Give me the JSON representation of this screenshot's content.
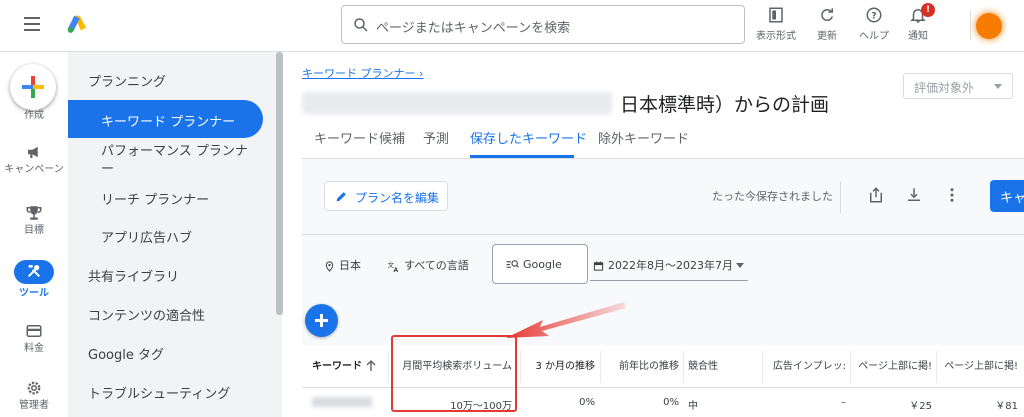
{
  "topbar": {
    "search_placeholder": "ページまたはキャンペーンを検索",
    "items": [
      {
        "label": "表示形式",
        "icon": "display-format-icon"
      },
      {
        "label": "更新",
        "icon": "refresh-icon"
      },
      {
        "label": "ヘルプ",
        "icon": "help-icon"
      },
      {
        "label": "通知",
        "icon": "bell-icon"
      }
    ],
    "notif_badge": "!"
  },
  "rail": {
    "create": "作成",
    "campaign": "キャンペーン",
    "goals": "目標",
    "tools": "ツール",
    "billing": "料金",
    "admin": "管理者"
  },
  "sidebar": {
    "planning": "プランニング",
    "keyword_planner": "キーワード プランナー",
    "performance_planner_line1": "パフォーマンス プランナ",
    "performance_planner_line2": "ー",
    "reach_planner": "リーチ プランナー",
    "app_ad_hub": "アプリ広告ハブ",
    "shared_library": "共有ライブラリ",
    "content_suitability": "コンテンツの適合性",
    "google_tag": "Google タグ",
    "troubleshooting": "トラブルシューティング"
  },
  "main": {
    "breadcrumb": "キーワード プランナー ›",
    "title": "日本標準時）からの計画",
    "eval_select": "評価対象外",
    "tabs": [
      "キーワード候補",
      "予測",
      "保存したキーワード",
      "除外キーワード"
    ],
    "edit_plan": "プラン名を編集",
    "saved_status": "たった今保存されました",
    "blue_button": "キャン",
    "filters": {
      "location": "日本",
      "language": "すべての言語",
      "network": "Google",
      "date_range": "2022年8月～2023年7月"
    },
    "table": {
      "headers": {
        "keyword": "キーワード",
        "avg_monthly": "月間平均検索ボリューム",
        "three_month": "3 か月の推移",
        "yoy": "前年比の推移",
        "competition": "競合性",
        "impression_share": "広告インプレッ:",
        "top_bid_low": "ページ上部に掲!",
        "top_bid_high": "ページ上部に掲!"
      },
      "row": {
        "avg_monthly": "10万～100万",
        "three_month": "0%",
        "yoy": "0%",
        "competition": "中",
        "impression_share": "–",
        "top_bid_low": "￥25",
        "top_bid_high": "￥81"
      }
    }
  },
  "colors": {
    "accent": "#1a73e8",
    "annotation": "#e53935",
    "avatar": "#f57c00"
  }
}
